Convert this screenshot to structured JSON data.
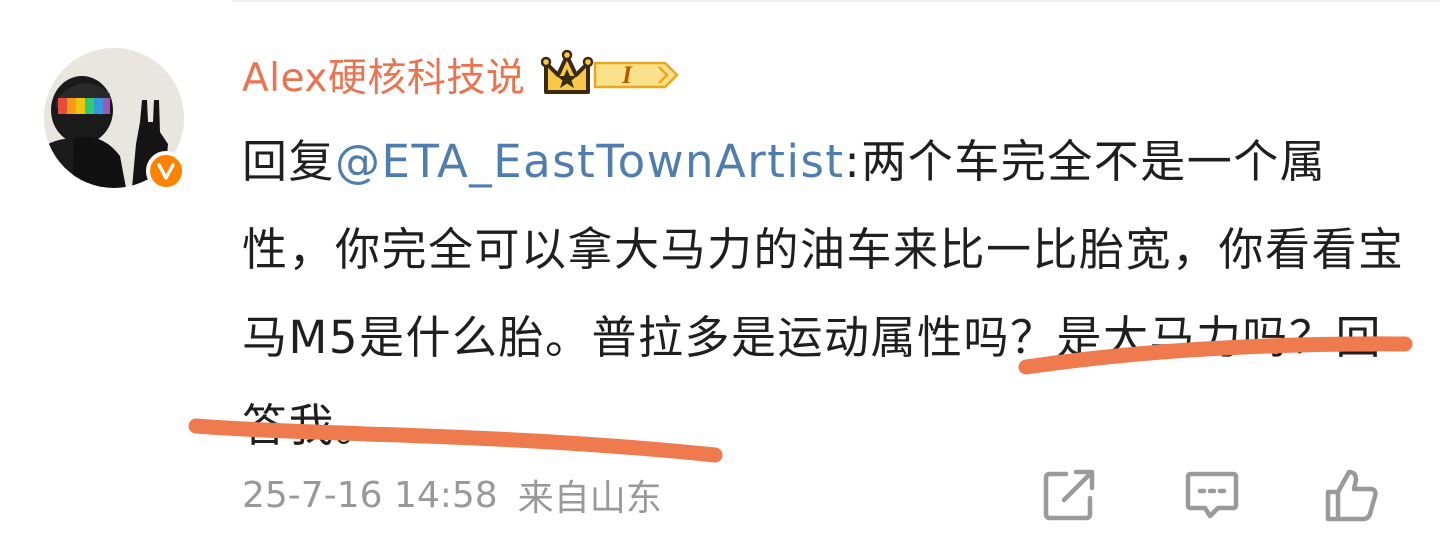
{
  "comment": {
    "author_name": "Alex硬核科技说",
    "member_badge_label": "I",
    "reply_prefix": "回复",
    "mention": "@ETA_EastTownArtist",
    "text_segments": [
      ":两个车完全不是一个属性，你完全可以拿大马力的油车来比一比胎宽，你看看宝马M5是什么胎。",
      "普拉多是运动属性吗？",
      "是大马力吗？",
      "回答我。"
    ],
    "timestamp": "25-7-16 14:58",
    "source": "来自山东"
  },
  "icons": {
    "avatar": "avatar-helmet-rock-hand",
    "verified": "verified-v-icon",
    "member_badge": "crown-badge-icon",
    "share": "share-icon",
    "comment": "comment-icon",
    "like": "like-icon"
  },
  "colors": {
    "author_name": "#eb7350",
    "mention_link": "#507daf",
    "body_text": "#1f1f1f",
    "meta_text": "#999999",
    "annotation_stroke": "#ef7a4e",
    "verified_badge": "#ff8200"
  }
}
